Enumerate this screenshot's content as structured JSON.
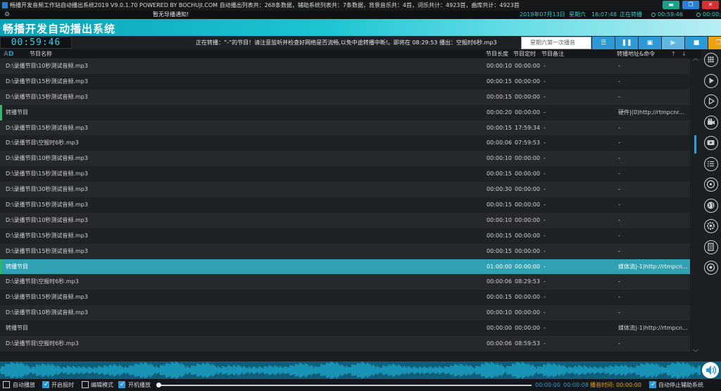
{
  "window": {
    "title": "畅播开发音频工作站自动播出系统2019 V9.0.1.70 POWERED BY BOCHUJI.COM 自动播出列表共：268条数据，辅助系统列表共：7条数据，背景音乐共：4首，词乐共计：4923首，曲库共计：4923首",
    "min_label": "▬",
    "max_label": "❐",
    "close_label": "✕"
  },
  "notice": {
    "text": "暂无导播通知!",
    "date": "2019年07月13日",
    "weekday": "星期六",
    "time": "16:07:48",
    "status": "正在转播",
    "countdown1": "00:59:46",
    "countdown2": "00:00:00"
  },
  "banner": {
    "app_name": "畅播开发自动播出系统"
  },
  "ticker": {
    "clock": "00:59:46",
    "message": "正在转播：“-”的节目！请注意监听并检查好网络是否流畅,以免中途转播中断!。即将在 08:29:53 播出：空报时6秒.mp3"
  },
  "search": {
    "placeholder": "星期六第一次播音"
  },
  "controls": [
    {
      "name": "list-button",
      "icon": "list-icon",
      "glyph": "☰",
      "disabled": false
    },
    {
      "name": "pause-button",
      "icon": "pause-icon",
      "glyph": "❚❚",
      "disabled": false
    },
    {
      "name": "save-button",
      "icon": "save-icon",
      "glyph": "▣",
      "disabled": false
    },
    {
      "name": "play-button",
      "icon": "play-icon",
      "glyph": "▶",
      "disabled": true
    },
    {
      "name": "stop-button",
      "icon": "stop-icon",
      "glyph": "■",
      "disabled": false
    },
    {
      "name": "window-button",
      "icon": "window-icon",
      "glyph": "❐",
      "disabled": false,
      "accent": "#f0a20c"
    }
  ],
  "table": {
    "logo": "A",
    "columns": {
      "name": "节目名称",
      "duration": "节目长度",
      "scheduled": "节目定时",
      "note": "节目备注",
      "address": "转播地址&命令"
    },
    "rows": [
      {
        "name": "D:\\录播节目\\10秒测试音频.mp3",
        "duration": "00:00:10",
        "time": "00:00:00",
        "note": "-",
        "address": "-",
        "relay": false,
        "selected": false
      },
      {
        "name": "D:\\录播节目\\15秒测试音频.mp3",
        "duration": "00:00:15",
        "time": "00:00:00",
        "note": "-",
        "address": "-",
        "relay": false,
        "selected": false
      },
      {
        "name": "D:\\录播节目\\15秒测试音频.mp3",
        "duration": "00:00:15",
        "time": "00:00:00",
        "note": "-",
        "address": "-",
        "relay": false,
        "selected": false
      },
      {
        "name": "转播节目",
        "duration": "00:00:20",
        "time": "00:00:00",
        "note": "-",
        "address": "硬件|(0)http://rtmpcnr...",
        "relay": true,
        "selected": false
      },
      {
        "name": "D:\\录播节目\\15秒测试音频.mp3",
        "duration": "00:00:15",
        "time": "17:59:34",
        "note": "-",
        "address": "-",
        "relay": false,
        "selected": false
      },
      {
        "name": "D:\\录播节目\\空报时6秒.mp3",
        "duration": "00:00:06",
        "time": "07:59:53",
        "note": "-",
        "address": "-",
        "relay": false,
        "selected": false
      },
      {
        "name": "D:\\录播节目\\10秒测试音频.mp3",
        "duration": "00:00:10",
        "time": "00:00:00",
        "note": "-",
        "address": "-",
        "relay": false,
        "selected": false
      },
      {
        "name": "D:\\录播节目\\15秒测试音频.mp3",
        "duration": "00:00:15",
        "time": "00:00:00",
        "note": "-",
        "address": "-",
        "relay": false,
        "selected": false
      },
      {
        "name": "D:\\录播节目\\30秒测试音频.mp3",
        "duration": "00:00:30",
        "time": "00:00:00",
        "note": "-",
        "address": "-",
        "relay": false,
        "selected": false
      },
      {
        "name": "D:\\录播节目\\15秒测试音频.mp3",
        "duration": "00:00:15",
        "time": "00:00:00",
        "note": "-",
        "address": "-",
        "relay": false,
        "selected": false
      },
      {
        "name": "D:\\录播节目\\10秒测试音频.mp3",
        "duration": "00:00:10",
        "time": "00:00:00",
        "note": "-",
        "address": "-",
        "relay": false,
        "selected": false
      },
      {
        "name": "D:\\录播节目\\15秒测试音频.mp3",
        "duration": "00:00:15",
        "time": "00:00:00",
        "note": "-",
        "address": "-",
        "relay": false,
        "selected": false
      },
      {
        "name": "D:\\录播节目\\15秒测试音频.mp3",
        "duration": "00:00:15",
        "time": "00:00:00",
        "note": "-",
        "address": "-",
        "relay": false,
        "selected": false
      },
      {
        "name": "转播节目",
        "duration": "01:00:00",
        "time": "00:00:00",
        "note": "-",
        "address": "媒体流|-1)http://rtmpcn...",
        "relay": true,
        "selected": true
      },
      {
        "name": "D:\\录播节目\\空报时6秒.mp3",
        "duration": "00:00:06",
        "time": "08:29:53",
        "note": "-",
        "address": "-",
        "relay": false,
        "selected": false
      },
      {
        "name": "D:\\录播节目\\15秒测试音频.mp3",
        "duration": "00:00:15",
        "time": "00:00:00",
        "note": "-",
        "address": "-",
        "relay": false,
        "selected": false
      },
      {
        "name": "D:\\录播节目\\10秒测试音频.mp3",
        "duration": "00:00:10",
        "time": "00:00:00",
        "note": "-",
        "address": "-",
        "relay": false,
        "selected": false
      },
      {
        "name": "转播节目",
        "duration": "00:00:00",
        "time": "00:00:00",
        "note": "-",
        "address": "媒体流|-1)http://rtmpcn...",
        "relay": false,
        "selected": false
      },
      {
        "name": "D:\\录播节目\\空报时6秒.mp3",
        "duration": "00:00:06",
        "time": "08:59:53",
        "note": "-",
        "address": "-",
        "relay": false,
        "selected": false
      }
    ]
  },
  "sidebar_icons": [
    "grid-icon",
    "play-circle-icon",
    "play-outline-icon",
    "camera-icon",
    "video-icon",
    "list-icon",
    "disc-icon",
    "globe-icon",
    "settings-icon",
    "document-icon",
    "chrome-icon"
  ],
  "bottom": {
    "auto_play": {
      "label": "自动播放",
      "checked": false
    },
    "time_signal": {
      "label": "开启报时",
      "checked": true
    },
    "edit_mode": {
      "label": "编辑模式",
      "checked": false
    },
    "power_on_play": {
      "label": "开机播放",
      "checked": true
    },
    "auto_stop_aux": {
      "label": "自动停止辅助系统",
      "checked": true
    },
    "position": "00:00:00",
    "total": "00:00:08",
    "remaining_label": "播音时间:",
    "remaining": "00:00:00",
    "progress": 0
  },
  "colors": {
    "accent": "#2b9ad7",
    "cyan": "#36c7c7",
    "selected": "#30a0b3",
    "relay_marker": "#35b56a",
    "orange": "#e8a21a"
  }
}
